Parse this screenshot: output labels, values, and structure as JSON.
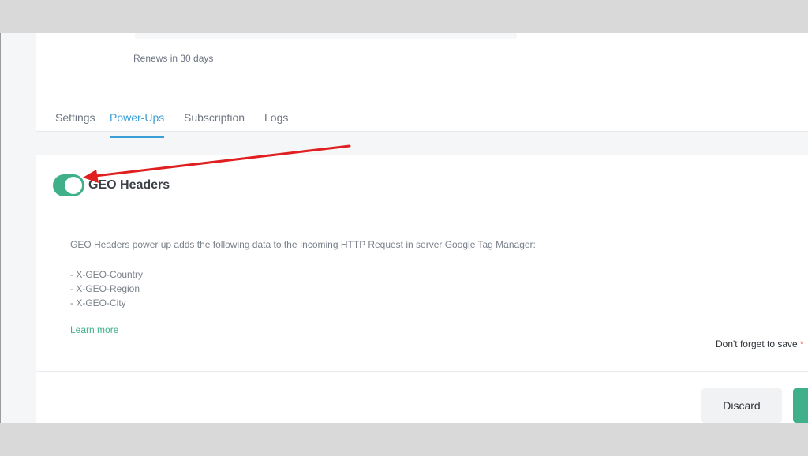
{
  "plan": {
    "renews_text": "Renews in 30 days"
  },
  "tabs": [
    {
      "label": "Settings",
      "active": false
    },
    {
      "label": "Power-Ups",
      "active": true
    },
    {
      "label": "Subscription",
      "active": false
    },
    {
      "label": "Logs",
      "active": false
    }
  ],
  "powerup": {
    "enabled": true,
    "title": "GEO Headers",
    "description": "GEO Headers power up adds the following data to the Incoming HTTP Request in server Google Tag Manager:",
    "headers": [
      "- X-GEO-Country",
      "- X-GEO-Region",
      "- X-GEO-City"
    ],
    "learn_more": "Learn more"
  },
  "footer": {
    "reminder": "Don't forget to save",
    "reminder_mark": "*",
    "discard_label": "Discard",
    "save_label": ""
  },
  "colors": {
    "accent_green": "#3fb08a",
    "tab_active_blue": "#3a9fd8",
    "annotation_red": "#e02020"
  }
}
